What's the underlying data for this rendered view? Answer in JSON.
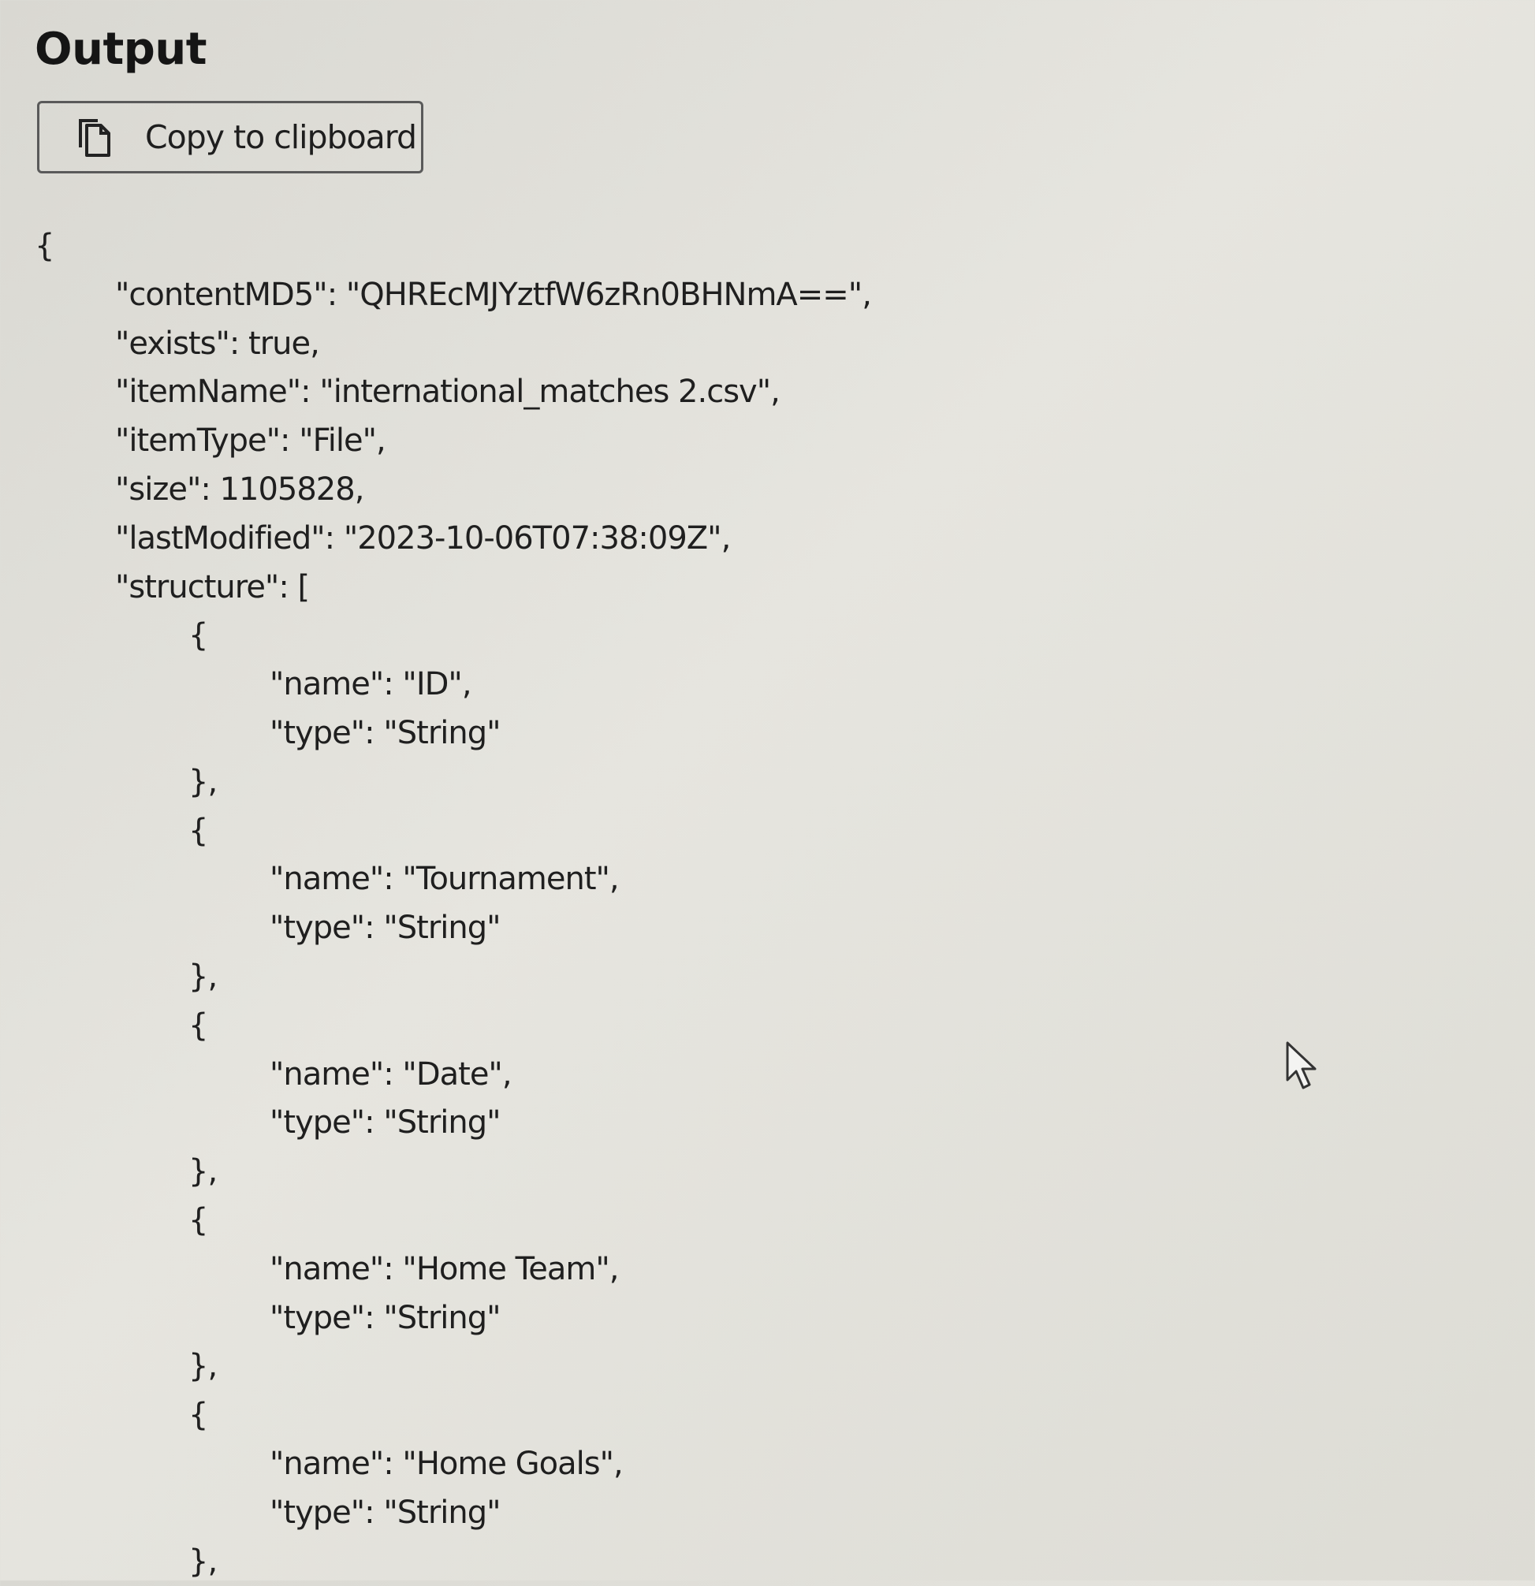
{
  "panel": {
    "title": "Output",
    "copy_button": {
      "label": "Copy to clipboard",
      "icon": "copy-icon"
    }
  },
  "json_lines": [
    "{",
    "\"contentMD5\": \"QHREcMJYztfW6zRn0BHNmA==\",",
    "\"exists\": true,",
    "\"itemName\": \"international_matches 2.csv\",",
    "\"itemType\": \"File\",",
    "\"size\": 1105828,",
    "\"lastModified\": \"2023-10-06T07:38:09Z\",",
    "\"structure\": [",
    "{",
    "\"name\": \"ID\",",
    "\"type\": \"String\"",
    "},",
    "{",
    "\"name\": \"Tournament\",",
    "\"type\": \"String\"",
    "},",
    "{",
    "\"name\": \"Date\",",
    "\"type\": \"String\"",
    "},",
    "{",
    "\"name\": \"Home Team\",",
    "\"type\": \"String\"",
    "},",
    "{",
    "\"name\": \"Home Goals\",",
    "\"type\": \"String\"",
    "},"
  ],
  "cursor": {
    "icon": "mouse-pointer-icon"
  }
}
